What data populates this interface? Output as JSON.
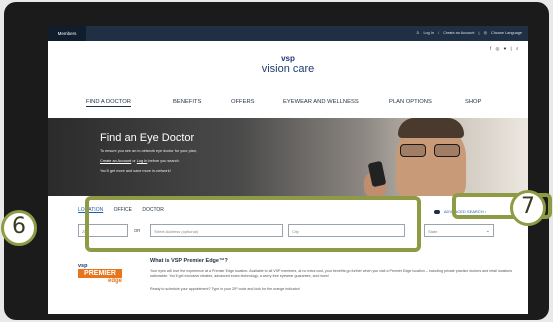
{
  "topbar": {
    "members_tab": "Members",
    "login_link": "Log In",
    "separator": "/",
    "create_account_link": "Create an Account",
    "divider": "|",
    "language": "Choose Language"
  },
  "social": {
    "icons": "f ◎ ♥ | ⌕"
  },
  "logo": {
    "brand": "vsp",
    "product": "vision care"
  },
  "nav": {
    "items": [
      "FIND A DOCTOR",
      "BENEFITS",
      "OFFERS",
      "EYEWEAR AND WELLNESS",
      "PLAN OPTIONS",
      "SHOP"
    ]
  },
  "hero": {
    "title": "Find an Eye Doctor",
    "line1": "To ensure you see an in-network eye doctor for your plan,",
    "create_account": "Create an Account",
    "or": "or",
    "login": "Log In",
    "line2_suffix": "before you search.",
    "line3": "You'll get more and save more in-network!"
  },
  "search": {
    "tabs": [
      "LOCATION",
      "OFFICE",
      "DOCTOR"
    ],
    "advanced_search": "ADVANCED SEARCH",
    "advanced_search_arrow": "›",
    "zip_placeholder": "Zip",
    "or_label": "OR",
    "street_placeholder": "Street Address (optional)",
    "city_placeholder": "City",
    "state_placeholder": "State"
  },
  "premier": {
    "logo_vsp": "vsp",
    "logo_premier": "PREMIER",
    "logo_edge": "edge",
    "title": "What is VSP Premier Edge™?",
    "body": "Your eyes will love the experience at a Premier Edge location. Available to all VSP members, at no extra cost, your benefits go further when you visit a Premier Edge location – including private practice doctors and retail locations nationwide. You'll get exclusive rebates, advanced exam technology, a worry-free eyewear guarantee, and more!",
    "cta": "Ready to schedule your appointment? Type in your ZIP code and look for the orange indicator!"
  },
  "callouts": {
    "six": "6",
    "seven": "7"
  },
  "colors": {
    "navy": "#1f3044",
    "link_blue": "#1f5fa8",
    "premier_orange": "#e8751a",
    "callout_green": "#8f9a45"
  }
}
